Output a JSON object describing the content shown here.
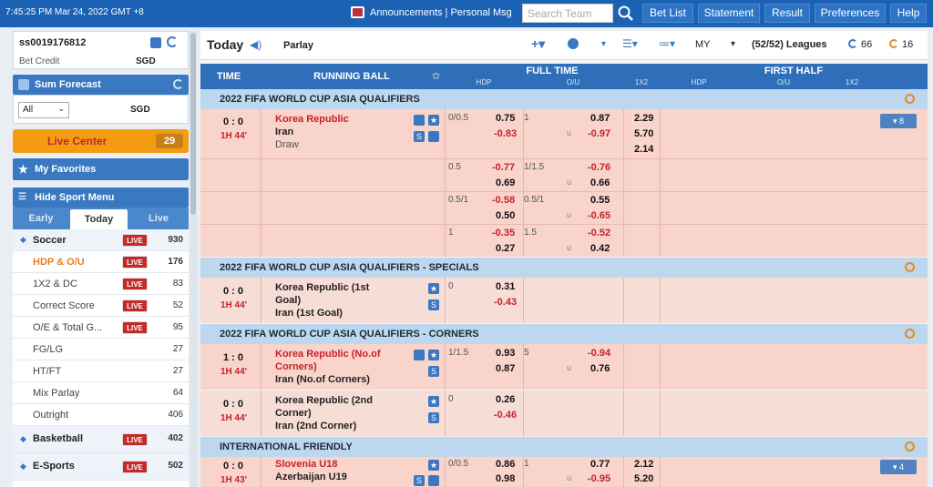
{
  "topbar": {
    "clock": "7:45:25 PM Mar 24, 2022 GMT +8",
    "announcements": "Announcements | Personal Msg",
    "search_placeholder": "Search Team",
    "nav": [
      "Bet List",
      "Statement",
      "Result",
      "Preferences",
      "Help"
    ]
  },
  "account": {
    "id": "ss0019176812",
    "credit_label": "Bet Credit",
    "currency": "SGD"
  },
  "sum_forecast": {
    "title": "Sum Forecast",
    "filter": "All",
    "currency": "SGD"
  },
  "live_center": {
    "label": "Live Center",
    "count": "29"
  },
  "favorites": {
    "label": "My Favorites"
  },
  "sport_menu": {
    "title": "Hide Sport Menu",
    "tabs": [
      "Early",
      "Today",
      "Live"
    ],
    "live_badge": "LIVE",
    "items": [
      {
        "label": "Soccer",
        "count": "930",
        "badge": true
      },
      {
        "label": "HDP & O/U",
        "count": "176",
        "badge": true
      },
      {
        "label": "1X2 & DC",
        "count": "83",
        "badge": true
      },
      {
        "label": "Correct Score",
        "count": "52",
        "badge": true
      },
      {
        "label": "O/E & Total G...",
        "count": "95",
        "badge": true
      },
      {
        "label": "FG/LG",
        "count": "27",
        "badge": false
      },
      {
        "label": "HT/FT",
        "count": "27",
        "badge": false
      },
      {
        "label": "Mix Parlay",
        "count": "64",
        "badge": false
      },
      {
        "label": "Outright",
        "count": "406",
        "badge": false
      },
      {
        "label": "Basketball",
        "count": "402",
        "badge": true
      },
      {
        "label": "E-Sports",
        "count": "502",
        "badge": true
      }
    ]
  },
  "toolbar": {
    "title": "Today",
    "parlay": "Parlay",
    "odds_type": "MY",
    "leagues": "(52/52) Leagues",
    "count_a": "66",
    "count_b": "16"
  },
  "table_header": {
    "time": "TIME",
    "running_ball": "RUNNING BALL",
    "full_time": "FULL TIME",
    "first_half": "FIRST HALF",
    "sub": [
      "HDP",
      "O/U",
      "1X2",
      "HDP",
      "O/U",
      "1X2"
    ]
  },
  "leagues": [
    {
      "name": "2022 FIFA WORLD CUP ASIA QUALIFIERS"
    },
    {
      "name": "2022 FIFA WORLD CUP ASIA QUALIFIERS - SPECIALS"
    },
    {
      "name": "2022 FIFA WORLD CUP ASIA QUALIFIERS - CORNERS"
    },
    {
      "name": "INTERNATIONAL FRIENDLY"
    }
  ],
  "m1": {
    "score": "0 : 0",
    "period": "1H 44'",
    "home": "Korea Republic",
    "away": "Iran",
    "draw": "Draw",
    "more": "▾ 8",
    "rows": [
      {
        "hdp": "0/0.5",
        "h1": "0.75",
        "h2": "-0.83",
        "ou": "1",
        "u": "u",
        "o1": "0.87",
        "o2": "-0.97"
      },
      {
        "hdp": "0.5",
        "h1": "-0.77",
        "h2": "0.69",
        "ou": "1/1.5",
        "u": "u",
        "o1": "-0.76",
        "o2": "0.66"
      },
      {
        "hdp": "0.5/1",
        "h1": "-0.58",
        "h2": "0.50",
        "ou": "0.5/1",
        "u": "u",
        "o1": "0.55",
        "o2": "-0.65"
      },
      {
        "hdp": "1",
        "h1": "-0.35",
        "h2": "0.27",
        "ou": "1.5",
        "u": "u",
        "o1": "-0.52",
        "o2": "0.42"
      }
    ],
    "x12": [
      "2.29",
      "5.70",
      "2.14"
    ]
  },
  "m2": {
    "score": "0 : 0",
    "period": "1H 44'",
    "home1": "Korea Republic (1st",
    "home2": "Goal)",
    "away": "Iran (1st Goal)",
    "hdp": "0",
    "h1": "0.31",
    "h2": "-0.43"
  },
  "m3": {
    "score": "1 : 0",
    "period": "1H 44'",
    "home1": "Korea Republic (No.of",
    "home2": "Corners)",
    "away": "Iran (No.of Corners)",
    "hdp": "1/1.5",
    "h1": "0.93",
    "h2": "0.87",
    "ou": "5",
    "u": "u",
    "o1": "-0.94",
    "o2": "0.76"
  },
  "m4": {
    "score": "0 : 0",
    "period": "1H 44'",
    "home1": "Korea Republic (2nd",
    "home2": "Corner)",
    "away": "Iran (2nd Corner)",
    "hdp": "0",
    "h1": "0.26",
    "h2": "-0.46"
  },
  "m5": {
    "score": "0 : 0",
    "period": "1H 43'",
    "home": "Slovenia U18",
    "away": "Azerbaijan U19",
    "hdp": "0/0.5",
    "h1": "0.86",
    "h2": "0.98",
    "ou": "1",
    "u": "u",
    "o1": "0.77",
    "o2": "-0.95",
    "x12": [
      "2.12",
      "5.20"
    ],
    "more": "▾ 4"
  }
}
